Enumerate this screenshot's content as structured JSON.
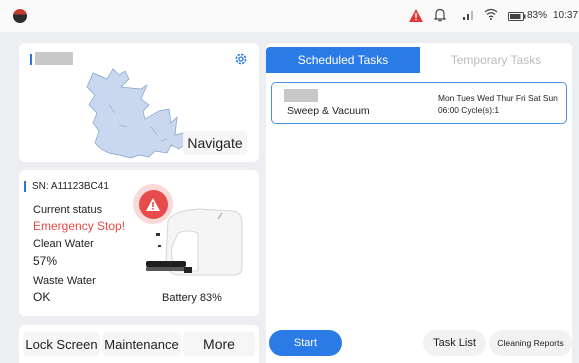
{
  "status_bar": {
    "battery": "83%",
    "time": "10:37",
    "icons": [
      "app-logo",
      "alert-triangle-icon",
      "bell-icon",
      "signal-icon",
      "wifi-icon",
      "battery-icon"
    ]
  },
  "map_card": {
    "navigate_label": "Navigate",
    "icons": [
      "settings-icon"
    ]
  },
  "status_card": {
    "sn": "SN: A11123BC41",
    "current_status_label": "Current status",
    "current_status_value": "Emergency Stop!",
    "clean_water_label": "Clean Water",
    "clean_water_value": "57%",
    "waste_water_label": "Waste Water",
    "waste_water_value": "OK",
    "battery": "Battery 83%",
    "icons": [
      "warning-icon",
      "robot-illustration"
    ]
  },
  "bottom_buttons": {
    "lock_screen": "Lock Screen",
    "maintenance": "Maintenance",
    "more": "More"
  },
  "tabs": {
    "scheduled": "Scheduled Tasks",
    "temporary": "Temporary Tasks",
    "active": "scheduled"
  },
  "tasks": [
    {
      "name": "Sweep & Vacuum",
      "days": "Mon Tues Wed Thur Fri Sat Sun",
      "schedule": "06:00 Cycle(s):1"
    }
  ],
  "actions": {
    "start": "Start",
    "task_list": "Task List",
    "cleaning_reports": "Cleaning Reports"
  },
  "colors": {
    "accent": "#2a7be6",
    "emergency": "#e84a46",
    "background": "#eceef2",
    "map_fill": "#c9d8ee"
  }
}
